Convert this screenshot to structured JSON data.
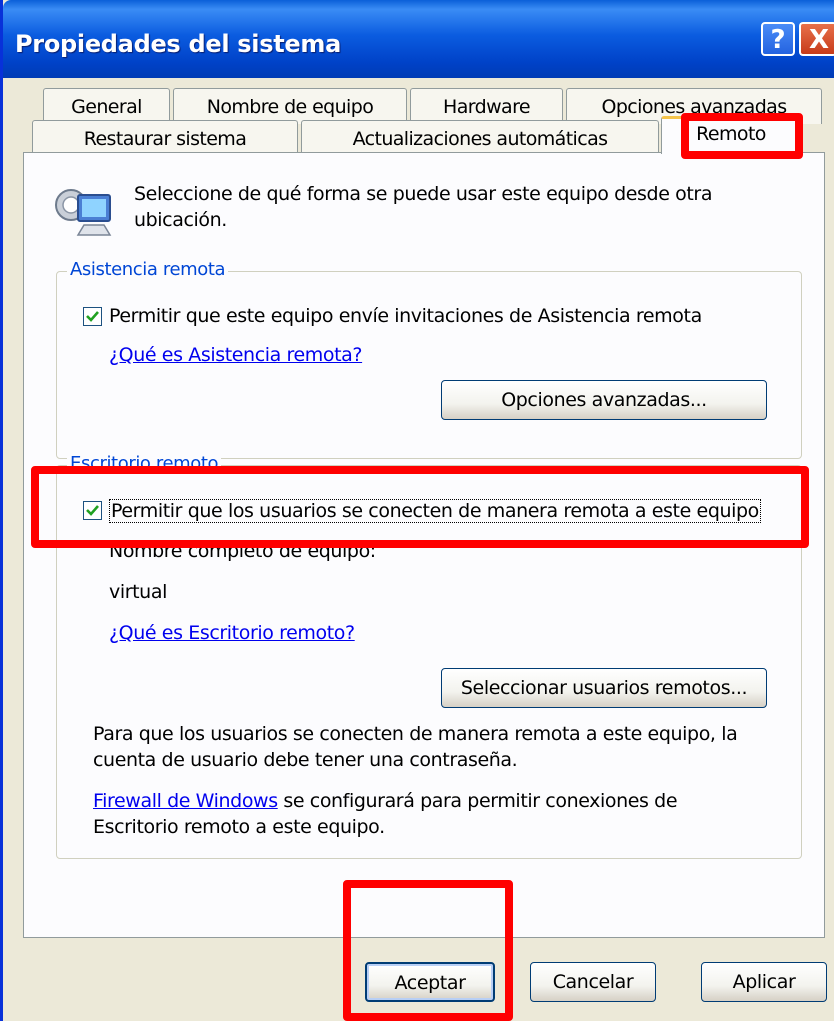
{
  "window": {
    "title": "Propiedades del sistema",
    "help_label": "?",
    "close_label": "X"
  },
  "tabs": {
    "row1": [
      "General",
      "Nombre de equipo",
      "Hardware",
      "Opciones avanzadas"
    ],
    "row2": [
      "Restaurar sistema",
      "Actualizaciones automáticas",
      "Remoto"
    ],
    "active": "Remoto"
  },
  "intro": {
    "line1": "Seleccione de qué forma se puede usar este equipo desde otra",
    "line2": "ubicación.",
    "icon": "computer-remote-icon"
  },
  "remote_assistance": {
    "legend": "Asistencia remota",
    "checkbox_label": "Permitir que este equipo envíe invitaciones de Asistencia remota",
    "checked": true,
    "help_link": "¿Qué es Asistencia remota?",
    "advanced_button": "Opciones avanzadas..."
  },
  "remote_desktop": {
    "legend": "Escritorio remoto",
    "checkbox_label": "Permitir que los usuarios se conecten de manera remota a este equipo",
    "checked": true,
    "full_name_label": "Nombre completo de equipo:",
    "computer_name": "virtual",
    "help_link": "¿Qué es Escritorio remoto?",
    "select_users_button": "Seleccionar usuarios remotos...",
    "note_line1": "Para que los usuarios se conecten de manera remota a este equipo, la",
    "note_line2": "cuenta de usuario debe tener una contraseña.",
    "firewall_link": "Firewall de Windows",
    "firewall_rest": " se configurará para permitir conexiones de",
    "firewall_line2": "Escritorio remoto a este equipo."
  },
  "footer": {
    "ok": "Aceptar",
    "cancel": "Cancelar",
    "apply": "Aplicar"
  },
  "colors": {
    "highlight": "#ff0000",
    "titlebar": "#0b5ce0",
    "legend": "#0046d5",
    "check": "#21a121"
  }
}
